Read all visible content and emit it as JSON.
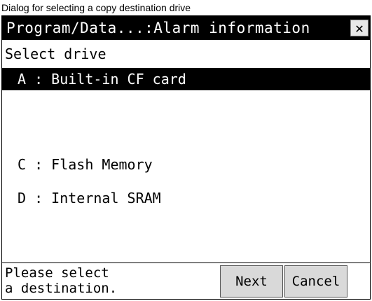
{
  "caption": "Dialog for selecting a copy destination drive",
  "dialog": {
    "title": "Program/Data...:Alarm information",
    "close_icon_glyph": "✕",
    "prompt": "Select drive",
    "drives": [
      {
        "label": "A : Built-in CF card",
        "selected": true
      },
      {
        "label": "C : Flash Memory",
        "selected": false
      },
      {
        "label": "D : Internal SRAM",
        "selected": false
      }
    ],
    "status_message": "Please select\na destination.",
    "next_label": "Next",
    "cancel_label": "Cancel"
  }
}
